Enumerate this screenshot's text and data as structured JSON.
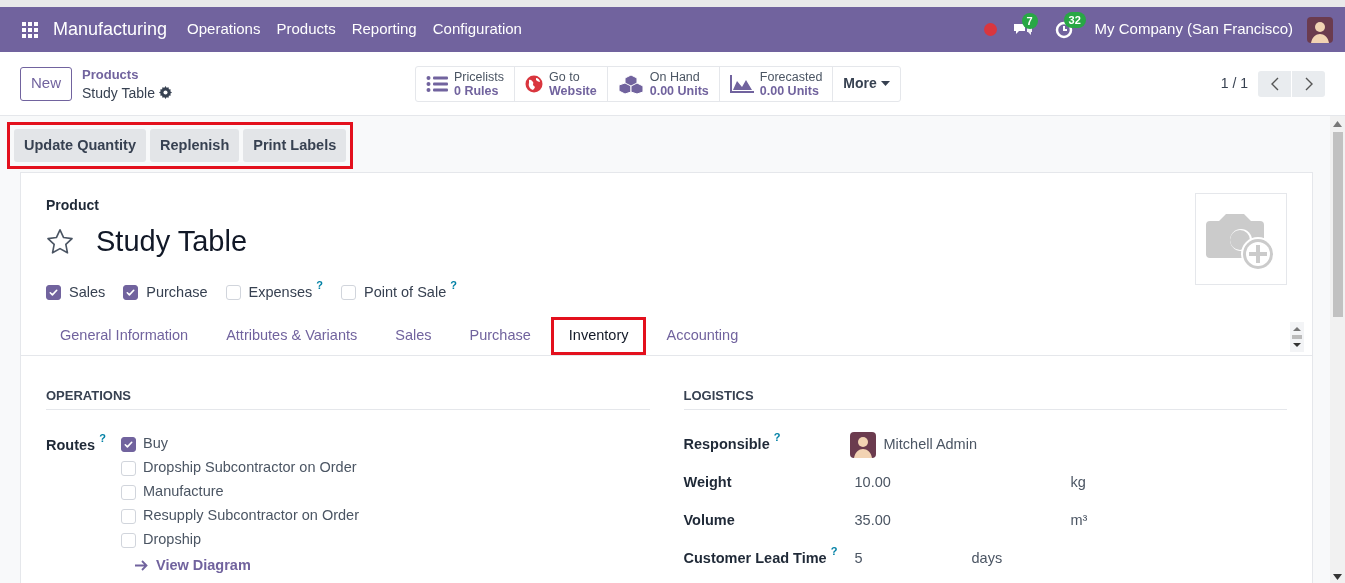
{
  "navbar": {
    "app": "Manufacturing",
    "menus": [
      "Operations",
      "Products",
      "Reporting",
      "Configuration"
    ],
    "recording": true,
    "messages_badge": "7",
    "activities_badge": "32",
    "company": "My Company (San Francisco)"
  },
  "control_panel": {
    "new_button": "New",
    "breadcrumb": "Products",
    "record_title": "Study Table",
    "smart_buttons": [
      {
        "kind": "list",
        "label": "Pricelists",
        "value": "0 Rules"
      },
      {
        "kind": "globe",
        "label": "Go to",
        "value": "Website"
      },
      {
        "kind": "cubes",
        "label": "On Hand",
        "value": "0.00 Units"
      },
      {
        "kind": "chart",
        "label": "Forecasted",
        "value": "0.00 Units"
      }
    ],
    "more_button": "More",
    "pager": "1 / 1"
  },
  "action_buttons": {
    "highlighted": true,
    "items": [
      "Update Quantity",
      "Replenish",
      "Print Labels"
    ]
  },
  "form": {
    "label": "Product",
    "favorite": false,
    "name": "Study Table",
    "options": [
      {
        "label": "Sales",
        "checked": true
      },
      {
        "label": "Purchase",
        "checked": true
      },
      {
        "label": "Expenses",
        "checked": false,
        "help": "?"
      },
      {
        "label": "Point of Sale",
        "checked": false,
        "help": "?"
      }
    ],
    "tabs": [
      {
        "label": "General Information",
        "selected": false,
        "highlighted": false
      },
      {
        "label": "Attributes & Variants",
        "selected": false,
        "highlighted": false
      },
      {
        "label": "Sales",
        "selected": false,
        "highlighted": false
      },
      {
        "label": "Purchase",
        "selected": false,
        "highlighted": false
      },
      {
        "label": "Inventory",
        "selected": true,
        "highlighted": true
      },
      {
        "label": "Accounting",
        "selected": false,
        "highlighted": false
      }
    ],
    "operations": {
      "title": "OPERATIONS",
      "routes_label": "Routes",
      "routes_help": "?",
      "routes": [
        {
          "label": "Buy",
          "checked": true
        },
        {
          "label": "Dropship Subcontractor on Order",
          "checked": false
        },
        {
          "label": "Manufacture",
          "checked": false
        },
        {
          "label": "Resupply Subcontractor on Order",
          "checked": false
        },
        {
          "label": "Dropship",
          "checked": false
        }
      ],
      "diagram_link": "View Diagram"
    },
    "logistics": {
      "title": "LOGISTICS",
      "responsible_label": "Responsible",
      "responsible_help": "?",
      "responsible": "Mitchell Admin",
      "fields": [
        {
          "label": "Weight",
          "value": "10.00",
          "unit": "kg"
        },
        {
          "label": "Volume",
          "value": "35.00",
          "unit": "m³"
        },
        {
          "label": "Customer Lead Time",
          "value": "5",
          "unit": "days",
          "help": "?"
        }
      ]
    }
  }
}
